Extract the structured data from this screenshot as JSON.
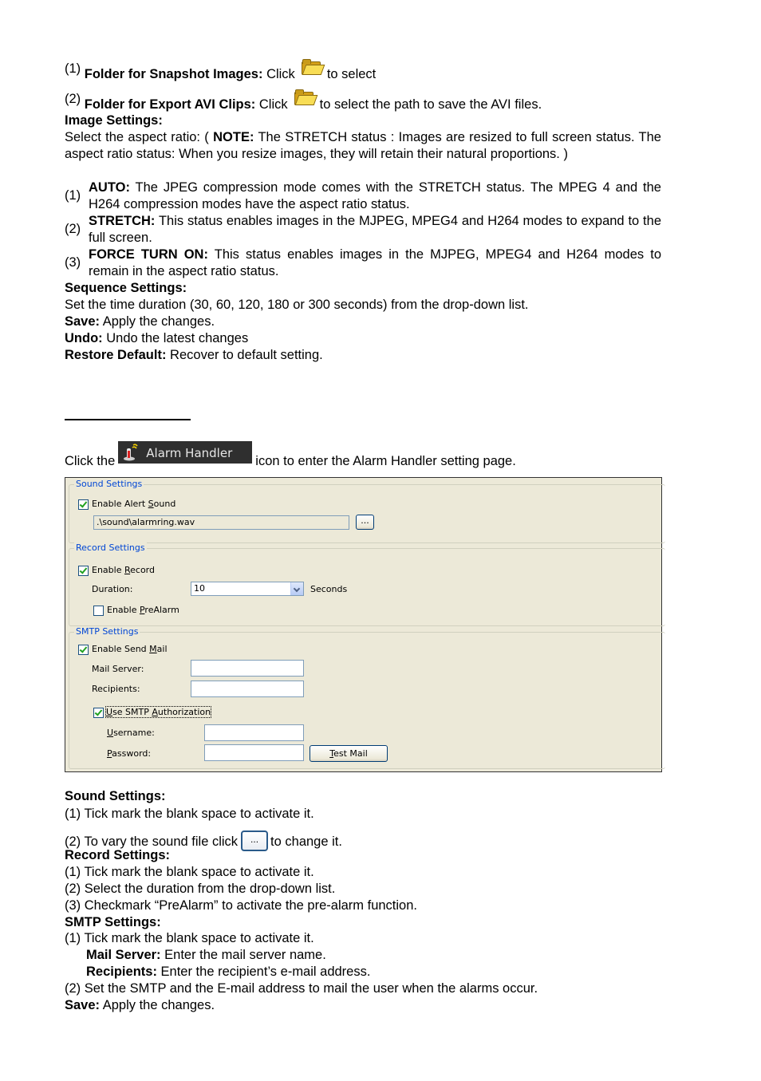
{
  "top_section": {
    "snapshot_item": {
      "num": "(1)",
      "label": "Folder for Snapshot Images:",
      "pre": "Click",
      "post": "to select",
      "icon": "folder-open-icon"
    },
    "avi_item": {
      "num": "(2)",
      "label": "Folder for Export AVI Clips:",
      "pre": "Click",
      "post": "to select the path to save the AVI files.",
      "icon": "folder-open-icon"
    },
    "image_settings_heading": "Image Settings:",
    "aspect_intro_pre": "Select the aspect ratio: (",
    "aspect_note_label": "NOTE:",
    "aspect_intro_post": "The STRETCH status : Images are resized to full screen status. The aspect ratio status: When you resize images, they will retain their natural proportions. )",
    "modes": [
      {
        "num": "(1)",
        "label": "AUTO:",
        "text": "The JPEG compression mode comes with the STRETCH status. The MPEG 4 and the H264 compression modes have the aspect ratio status."
      },
      {
        "num": "(2)",
        "label": "STRETCH:",
        "text": "This status enables images in the MJPEG, MPEG4 and H264 modes to expand to the full screen."
      },
      {
        "num": "(3)",
        "label": "FORCE TURN ON:",
        "text": "This status enables images in the MJPEG, MPEG4 and H264 modes to remain in the aspect ratio status."
      }
    ],
    "sequence_heading": "Sequence Settings:",
    "sequence_text": "Set the time duration (30, 60, 120, 180 or 300 seconds) from the drop-down list.",
    "save": {
      "label": "Save:",
      "text": "Apply the changes."
    },
    "undo": {
      "label": "Undo:",
      "text": "Undo the latest changes"
    },
    "restore": {
      "label": "Restore Default:",
      "text": "Recover to default setting."
    }
  },
  "alarm_intro": {
    "pre": "Click the",
    "button_label": "Alarm Handler",
    "button_icon": "alarm-handler-icon",
    "post": "icon to enter the Alarm Handler setting page."
  },
  "panel": {
    "sound": {
      "legend": "Sound Settings",
      "enable_label": "Enable Alert Sound",
      "enable_checked": true,
      "file_value": ".\\sound\\alarmring.wav",
      "browse_label": "..."
    },
    "record": {
      "legend": "Record Settings",
      "enable_label": "Enable Record",
      "enable_checked": true,
      "duration_label": "Duration:",
      "duration_value": "10",
      "duration_unit": "Seconds",
      "prealarm_label": "Enable PreAlarm",
      "prealarm_checked": false
    },
    "smtp": {
      "legend": "SMTP Settings",
      "enable_label": "Enable Send Mail",
      "enable_checked": true,
      "mail_server_label": "Mail Server:",
      "mail_server_value": "",
      "recipients_label": "Recipients:",
      "recipients_value": "",
      "auth_label": "Use SMTP Authorization",
      "auth_checked": true,
      "username_label": "Username:",
      "username_value": "",
      "password_label": "Password:",
      "password_value": "",
      "test_mail_label": "Test Mail"
    }
  },
  "bottom_section": {
    "sound_heading": "Sound Settings:",
    "sound_1": "(1) Tick mark the blank space to activate it.",
    "sound_2_pre": "(2) To vary the sound file click",
    "sound_2_btn": "...",
    "sound_2_post": "to change it.",
    "record_heading": "Record Settings:",
    "record_1": "(1) Tick mark the blank space to activate it.",
    "record_2": "(2) Select the duration from the drop-down list.",
    "record_3": "(3) Checkmark “PreAlarm” to activate the pre-alarm function.",
    "smtp_heading": "SMTP Settings:",
    "smtp_1": "(1) Tick mark the blank space to activate it.",
    "mail_server": {
      "label": "Mail Server:",
      "text": "Enter the mail server name."
    },
    "recipients": {
      "label": "Recipients:",
      "text": "Enter the recipient’s e-mail address."
    },
    "smtp_2": "(2) Set the SMTP and the E-mail address to mail the user when the alarms occur.",
    "save": {
      "label": "Save:",
      "text": "Apply the changes."
    }
  }
}
